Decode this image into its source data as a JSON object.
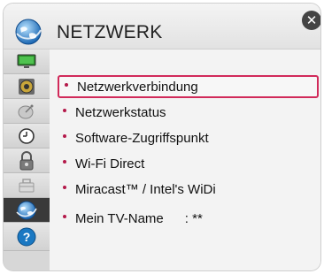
{
  "header": {
    "title": "NETZWERK",
    "close_glyph": "✕"
  },
  "icons": {
    "header": "globe-icon",
    "close": "close-icon",
    "sidebar": [
      "tv-screen-icon",
      "speaker-icon",
      "satellite-dish-icon",
      "clock-icon",
      "lock-icon",
      "toolbox-icon",
      "globe-icon",
      "help-icon"
    ]
  },
  "menu": {
    "items": [
      {
        "label": "Netzwerkverbindung",
        "selected": true
      },
      {
        "label": "Netzwerkstatus"
      },
      {
        "label": "Software-Zugriffspunkt"
      },
      {
        "label": "Wi-Fi Direct"
      },
      {
        "label": "Miracast™ / Intel's WiDi"
      },
      {
        "label": "Mein TV-Name",
        "value": ": **"
      }
    ]
  },
  "colors": {
    "selection_border": "#d12a5a",
    "bullet": "#b4194a",
    "active_sidebar": "#3a3a3a",
    "help_blue": "#1a78c2"
  }
}
